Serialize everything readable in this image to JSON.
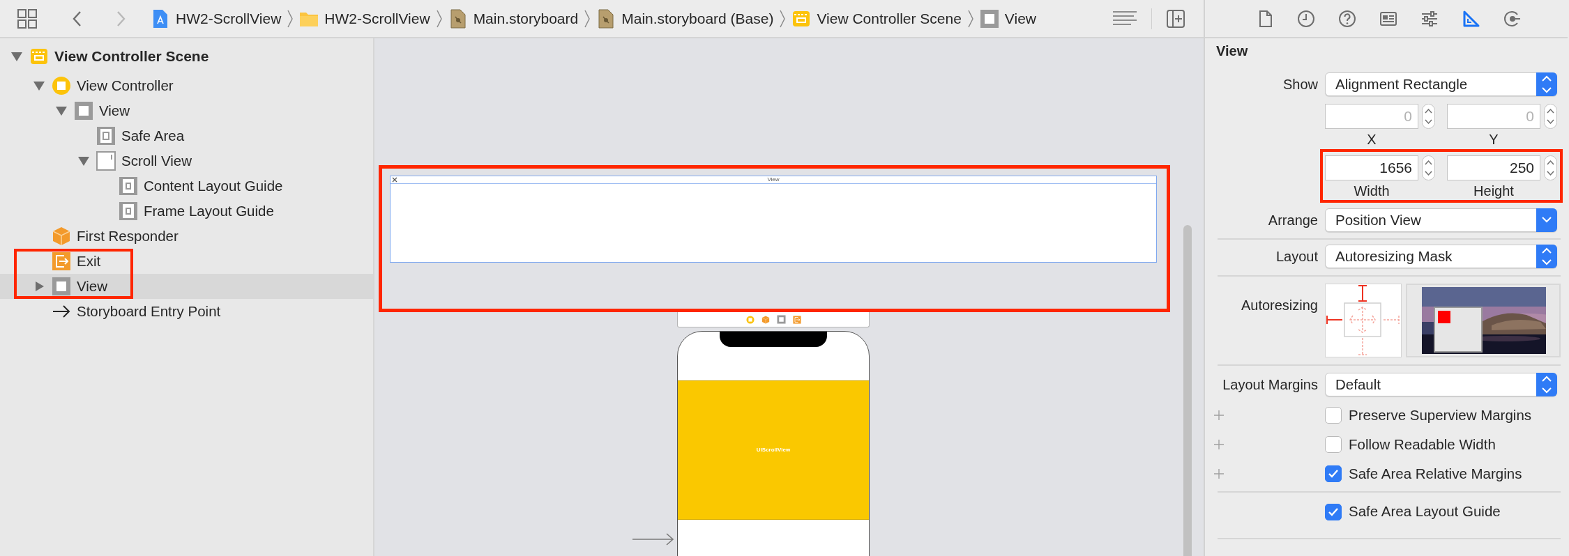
{
  "nav_buttons": [
    {
      "kind": "back",
      "disabled": false
    },
    {
      "kind": "forward",
      "disabled": true
    }
  ],
  "breadcrumbs": [
    {
      "kind": "project",
      "label": "HW2-ScrollView"
    },
    {
      "kind": "folder",
      "label": "HW2-ScrollView"
    },
    {
      "kind": "storyboard",
      "label": "Main.storyboard"
    },
    {
      "kind": "storyboard",
      "label": "Main.storyboard (Base)"
    },
    {
      "kind": "scene",
      "label": "View Controller Scene"
    },
    {
      "kind": "view",
      "label": "View"
    }
  ],
  "inspector_tabs": [
    {
      "kind": "file",
      "selected": false
    },
    {
      "kind": "history",
      "selected": false
    },
    {
      "kind": "help",
      "selected": false
    },
    {
      "kind": "identity",
      "selected": false
    },
    {
      "kind": "attributes",
      "selected": false
    },
    {
      "kind": "size",
      "selected": true
    },
    {
      "kind": "connections",
      "selected": false
    }
  ],
  "outline": [
    {
      "kind": "scene",
      "label": "View Controller Scene",
      "expanded": true,
      "selected": false,
      "highlighted": false,
      "children": [
        {
          "kind": "controller",
          "label": "View Controller",
          "expanded": true,
          "selected": false,
          "highlighted": false,
          "children": [
            {
              "kind": "view",
              "label": "View",
              "expanded": true,
              "selected": false,
              "highlighted": false,
              "children": [
                {
                  "kind": "safearea",
                  "label": "Safe Area",
                  "selected": false,
                  "highlighted": false
                },
                {
                  "kind": "scrollview",
                  "label": "Scroll View",
                  "expanded": true,
                  "selected": false,
                  "highlighted": false,
                  "children": [
                    {
                      "kind": "guide",
                      "label": "Content Layout Guide",
                      "selected": false,
                      "highlighted": false
                    },
                    {
                      "kind": "guide",
                      "label": "Frame Layout Guide",
                      "selected": false,
                      "highlighted": false
                    }
                  ]
                }
              ]
            }
          ]
        },
        {
          "kind": "responder",
          "label": "First Responder",
          "selected": false,
          "highlighted": false
        },
        {
          "kind": "exit",
          "label": "Exit",
          "selected": false,
          "highlighted": true
        },
        {
          "kind": "view",
          "label": "View",
          "expanded": false,
          "selected": true,
          "highlighted": true
        },
        {
          "kind": "entry",
          "label": "Storyboard Entry Point",
          "selected": false,
          "highlighted": false
        }
      ]
    }
  ],
  "canvas": {
    "floating_view": {
      "title": "View",
      "highlighted": true
    },
    "scroll_view_label": "UIScrollView"
  },
  "inspector": {
    "title": "View",
    "show": {
      "label": "Show",
      "value": "Alignment Rectangle",
      "kind": "popup"
    },
    "origin": [
      {
        "value": "0",
        "caption": "X",
        "disabled": true
      },
      {
        "value": "0",
        "caption": "Y",
        "disabled": true
      }
    ],
    "size": {
      "highlighted": true,
      "fields": [
        {
          "value": "1656",
          "caption": "Width",
          "disabled": false
        },
        {
          "value": "250",
          "caption": "Height",
          "disabled": false
        }
      ]
    },
    "arrange": {
      "label": "Arrange",
      "value": "Position View",
      "kind": "pulldown"
    },
    "layout": {
      "label": "Layout",
      "value": "Autoresizing Mask",
      "kind": "popup"
    },
    "autoresizing_label": "Autoresizing",
    "layout_margins": {
      "label": "Layout Margins",
      "value": "Default",
      "kind": "popup"
    },
    "margin_options": [
      {
        "label": "Preserve Superview Margins",
        "checked": false,
        "addable": true
      },
      {
        "label": "Follow Readable Width",
        "checked": false,
        "addable": true
      },
      {
        "label": "Safe Area Relative Margins",
        "checked": true,
        "addable": true
      }
    ],
    "safe_area_guide": {
      "label": "Safe Area Layout Guide",
      "checked": true,
      "addable": false
    }
  }
}
